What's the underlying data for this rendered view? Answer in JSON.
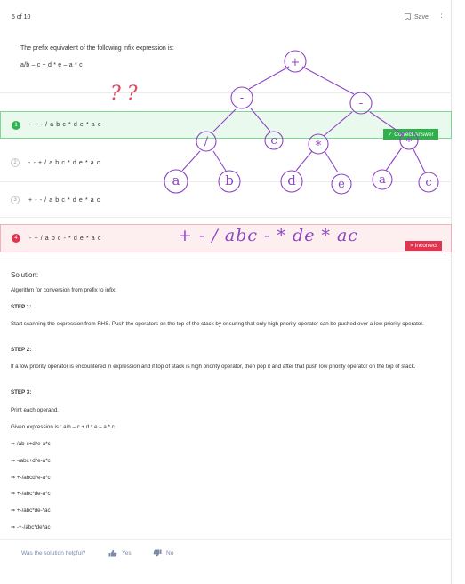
{
  "header": {
    "count": "5 of 10",
    "save_label": "Save",
    "more": "⋮"
  },
  "question": {
    "text": "The prefix equivalent of the following infix expression is:",
    "expression": "a/b – c + d * e – a * c"
  },
  "options": [
    {
      "number": "1",
      "label": "- + - / a b c * d e * a c",
      "state": "correct"
    },
    {
      "number": "2",
      "label": "- - + / a b c * d e * a c",
      "state": "none"
    },
    {
      "number": "3",
      "label": "+ - - / a b c * d e * a c",
      "state": "none"
    },
    {
      "number": "4",
      "label": "- + / a b c - * d e * a c",
      "state": "incorrect"
    }
  ],
  "badges": {
    "correct": "✓ Correct Answer",
    "incorrect": "× Incorrect"
  },
  "solution": {
    "title": "Solution:",
    "intro": "Algorithm for conversion from prefix to infix:",
    "step1_title": "STEP 1:",
    "step1_text": "Start scanning the expression from RHS. Push the operators on the top of the stack by ensuring that only high priority operator can be pushed over a low priority operator.",
    "step2_title": "STEP 2:",
    "step2_text": "If a low priority operator is encountered in expression and if top of stack is high priority operator, then pop it and after that push low priority operator on the top of stack.",
    "step3_title": "STEP 3:",
    "step3_text": "Print each operand.",
    "given": "Given expression is : a/b – c + d * e – a * c",
    "steps": [
      "⇒ /ab-c+d*e-a*c",
      "⇒ -/abc+d*e-a*c",
      "⇒ +-/abcd*e-a*c",
      "⇒ +-/abc*de-a*c",
      "⇒ +-/abc*de-*ac",
      "⇒ -+-/abc*de*ac"
    ]
  },
  "feedback": {
    "question": "Was the solution helpful?",
    "yes": "Yes",
    "no": "No"
  },
  "annotations": {
    "question_marks": "? ?",
    "handwritten_answer": "+ - / abc - * de * ac",
    "tree_root": "+",
    "tree_left": "-",
    "tree_right": "-",
    "tree_div": "/",
    "tree_c": "c",
    "tree_mul1": "*",
    "tree_mul2": "*",
    "tree_a1": "a",
    "tree_b": "b",
    "tree_d": "d",
    "tree_e": "e",
    "tree_a2": "a",
    "tree_c2": "c",
    "ink_color": "#8e44c4"
  },
  "colors": {
    "correct_bg": "#eaf9ee",
    "correct_border": "#7fd795",
    "correct_badge": "#2eb14b",
    "wrong_bg": "#fdeef0",
    "wrong_border": "#f2b2bd",
    "wrong_badge": "#e0344f"
  }
}
